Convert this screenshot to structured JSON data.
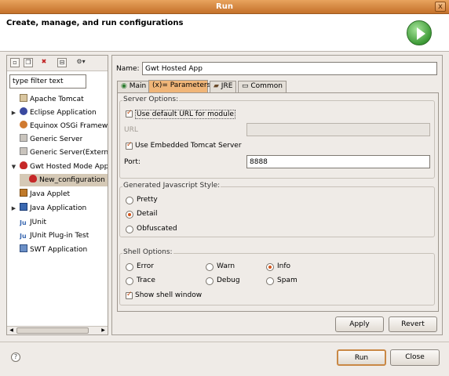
{
  "window": {
    "title": "Run",
    "close_glyph": "x"
  },
  "header": {
    "title": "Create, manage, and run configurations",
    "icon": "run-icon"
  },
  "left": {
    "toolbar": [
      "new-config-icon",
      "duplicate-icon",
      "delete-icon",
      "collapse-all-icon",
      "filter-icon"
    ],
    "filter_value": "type filter text",
    "tree": [
      {
        "label": "Apache Tomcat",
        "icon": "tomcat-icon"
      },
      {
        "label": "Eclipse Application",
        "icon": "eclipse-icon",
        "expandable": true
      },
      {
        "label": "Equinox OSGi Framew",
        "icon": "osgi-icon"
      },
      {
        "label": "Generic Server",
        "icon": "server-icon"
      },
      {
        "label": "Generic Server(Extern",
        "icon": "server-icon"
      },
      {
        "label": "Gwt Hosted Mode App",
        "icon": "gwt-icon",
        "expanded": true
      },
      {
        "label": "New_configuration",
        "icon": "gwt-icon",
        "child": true,
        "selected": true
      },
      {
        "label": "Java Applet",
        "icon": "applet-icon"
      },
      {
        "label": "Java Application",
        "icon": "java-icon",
        "expandable": true
      },
      {
        "label": "JUnit",
        "icon": "junit-icon"
      },
      {
        "label": "JUnit Plug-in Test",
        "icon": "junit-icon"
      },
      {
        "label": "SWT Application",
        "icon": "swt-icon"
      }
    ]
  },
  "config": {
    "name_label": "Name:",
    "name_value": "Gwt Hosted App",
    "tabs": [
      "Main",
      "Parameters",
      "JRE",
      "Common"
    ],
    "active_tab": "Parameters",
    "server": {
      "group_label": "Server Options:",
      "use_default_url": "Use default URL for module",
      "url_label": "URL",
      "url_value": "",
      "use_embedded": "Use Embedded Tomcat Server",
      "port_label": "Port:",
      "port_value": "8888"
    },
    "js_style": {
      "group_label": "Generated Javascript Style:",
      "options": [
        "Pretty",
        "Detail",
        "Obfuscated"
      ],
      "selected": "Detail"
    },
    "shell": {
      "group_label": "Shell Options:",
      "options": [
        "Error",
        "Warn",
        "Info",
        "Trace",
        "Debug",
        "Spam"
      ],
      "selected": "Info",
      "show_window": "Show shell window"
    },
    "apply": "Apply",
    "revert": "Revert"
  },
  "footer": {
    "run": "Run",
    "close": "Close",
    "help_glyph": "?"
  }
}
